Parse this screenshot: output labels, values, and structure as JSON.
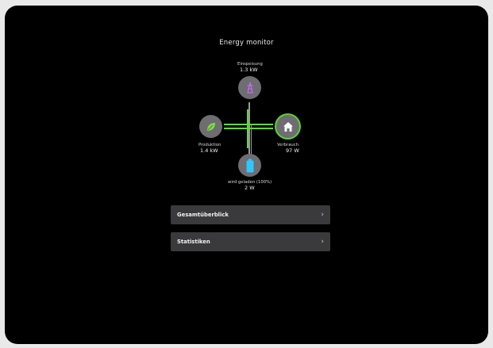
{
  "header": {
    "title": "Energy monitor"
  },
  "nodes": {
    "feed_in": {
      "label": "Einspeisung",
      "value": "1.3 kW",
      "icon": "transmission-tower-icon"
    },
    "production": {
      "label": "Produktion",
      "value": "1.4 kW",
      "icon": "leaf-icon"
    },
    "consumption": {
      "label": "Verbrauch",
      "value": "97 W",
      "icon": "home-icon"
    },
    "battery": {
      "label": "wird geladen (100%)",
      "value": "2 W",
      "icon": "battery-icon",
      "level_percent": 100
    }
  },
  "colors": {
    "flow_active": "#67d63a",
    "flow_idle": "#9a9a9a",
    "feed_in_accent": "#c66cf0",
    "production_accent": "#7be03a",
    "battery_accent": "#2ec7ff"
  },
  "menu": {
    "items": [
      {
        "label": "Gesamtüberblick"
      },
      {
        "label": "Statistiken"
      }
    ]
  }
}
